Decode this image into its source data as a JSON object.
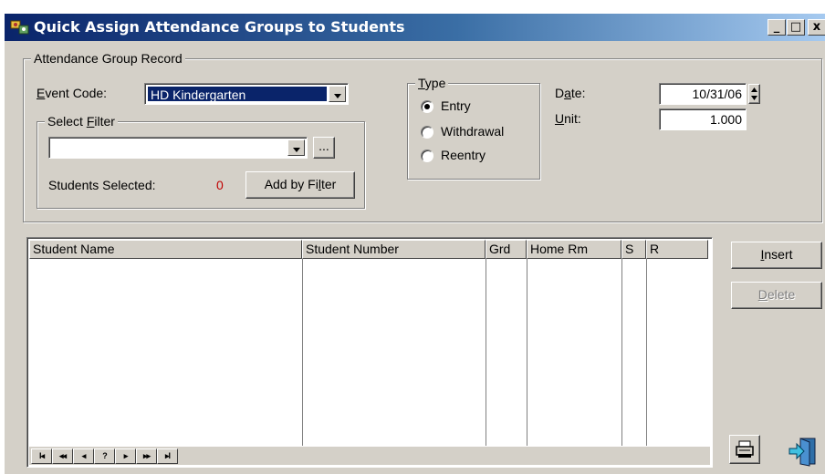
{
  "window": {
    "title": "Quick Assign Attendance Groups to Students",
    "controls": {
      "minimize": "_",
      "maximize": "□",
      "close": "x"
    }
  },
  "record_group": {
    "title": "Attendance Group Record",
    "event_code": {
      "label_u": "E",
      "label_rest": "vent Code:",
      "value": "HD Kindergarten"
    },
    "filter_group": {
      "title_pre": "Select ",
      "title_u": "F",
      "title_post": "ilter",
      "value": "",
      "ellipsis_label": "...",
      "students_selected_label": "Students Selected:",
      "students_selected_count": "0",
      "add_by_filter_pre": "Add by Fi",
      "add_by_filter_u": "l",
      "add_by_filter_post": "ter"
    },
    "type_group": {
      "title_u": "T",
      "title_rest": "ype",
      "options": [
        "Entry",
        "Withdrawal",
        "Reentry"
      ],
      "selected": "Entry"
    },
    "date": {
      "label_pre": "D",
      "label_u": "a",
      "label_post": "te:",
      "value": "10/31/06"
    },
    "unit": {
      "label_u": "U",
      "label_rest": "nit:",
      "value": "1.000"
    }
  },
  "grid": {
    "columns": [
      "Student Name",
      "Student Number",
      "Grd",
      "Home Rm",
      "S",
      "R"
    ],
    "rows": [],
    "nav_buttons": [
      "I◂",
      "◂◂",
      "◂",
      "?",
      "▸",
      "▸▸",
      "▸I"
    ]
  },
  "actions": {
    "insert_u": "I",
    "insert_rest": "nsert",
    "delete_u": "D",
    "delete_rest": "elete",
    "print_icon": "printer-icon",
    "exit_icon": "exit-icon"
  },
  "colors": {
    "face": "#d4d0c8",
    "title_start": "#0a246a",
    "title_end": "#a6caf0",
    "selection": "#0a246a",
    "count_red": "#c00000"
  }
}
